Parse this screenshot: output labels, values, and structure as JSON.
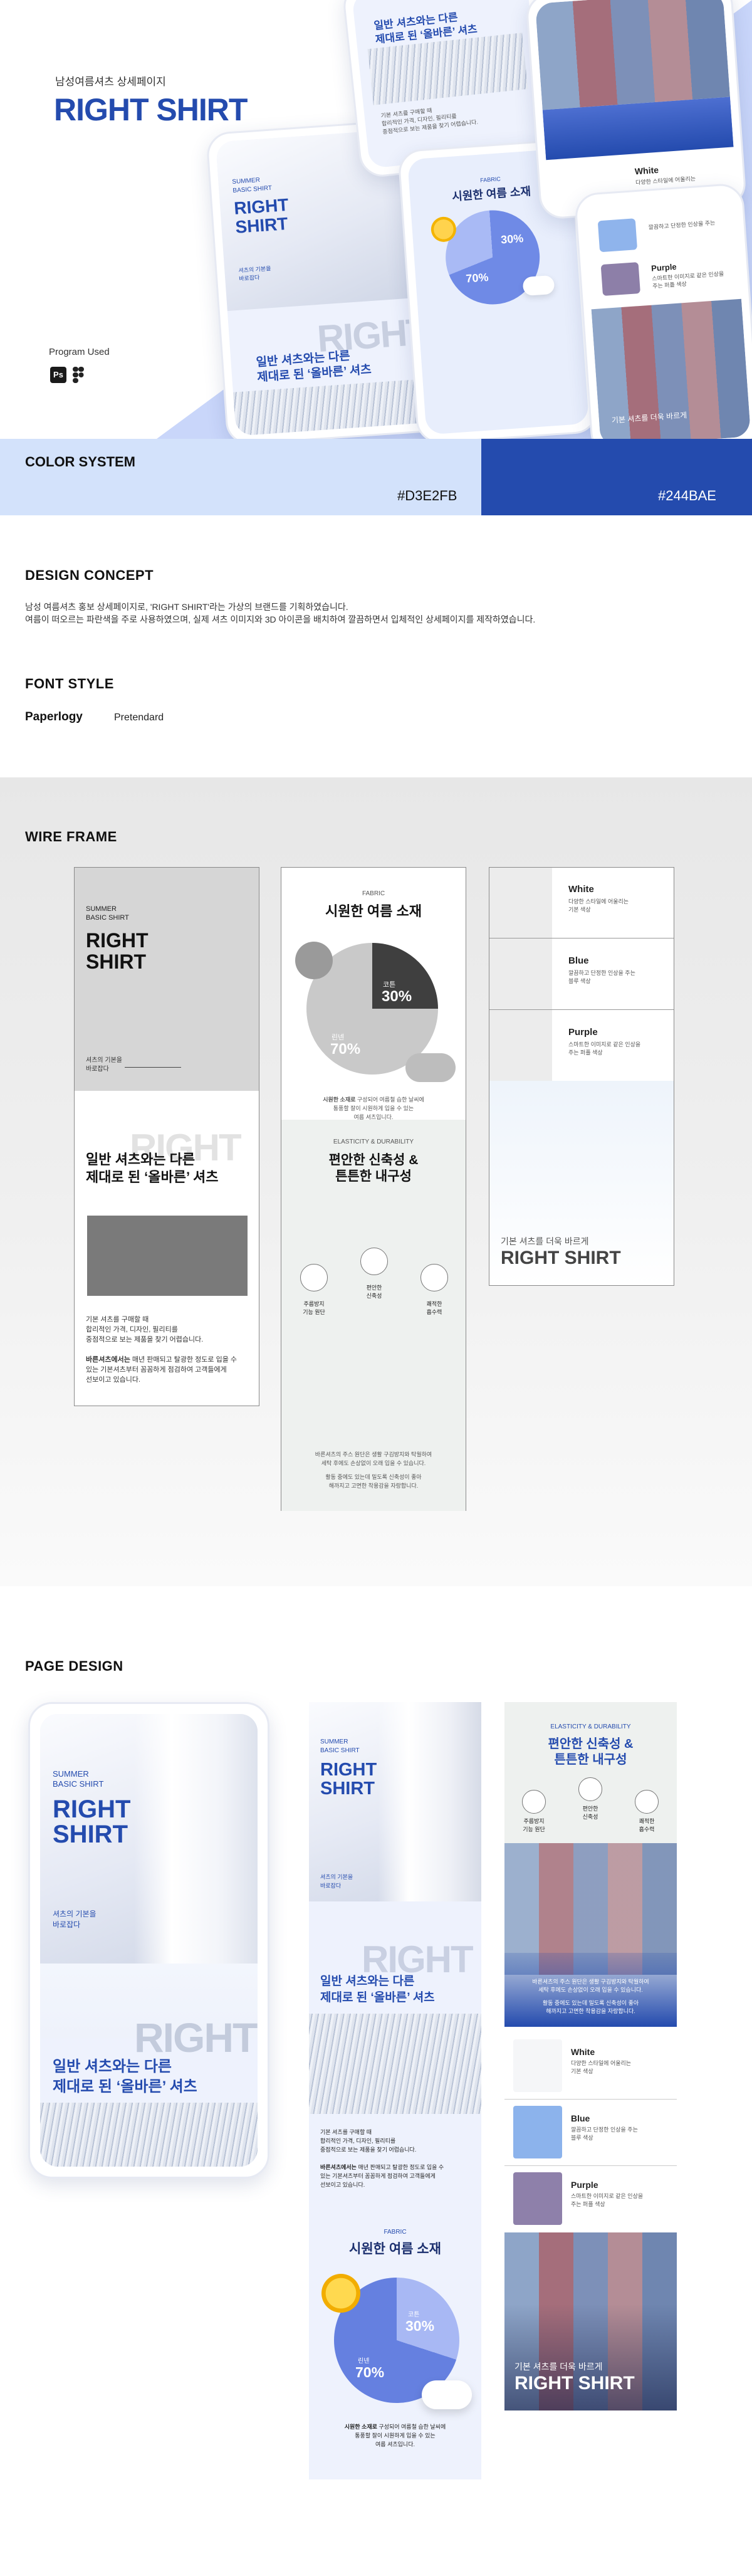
{
  "hero": {
    "subtitle": "남성여름셔츠 상세페이지",
    "title": "RIGHT SHIRT",
    "program_label": "Program Used",
    "program_icons": [
      "photoshop-icon",
      "figma-icon"
    ],
    "ps_text": "Ps"
  },
  "mock": {
    "summer": "SUMMER",
    "basic": "BASIC SHIRT",
    "right": "RIGHT",
    "shirt": "SHIRT",
    "side_note_1": "셔츠의 기본을",
    "side_note_2": "바로잡다",
    "bg_word": "RIGHT",
    "headline_1": "일반 셔츠와는 다른",
    "headline_2": "제대로 된 ‘올바른’ 셔츠",
    "fabric": "FABRIC",
    "fabric_title": "시원한 여름 소재",
    "pct_cotton_label": "코튼",
    "pct_cotton": "30%",
    "pct_linen_label": "린넨",
    "pct_linen": "70%",
    "body_1": "기본 셔츠를 구매할 때",
    "body_2": "합리적인 가격, 디자인, 필리티를",
    "body_3": "중점적으로 보는 제품을 찾기 어렵습니다.",
    "white": "White",
    "white_desc_1": "다양한 스타일에 어울리는",
    "white_desc_2": "기본 색상",
    "blue": "Blue",
    "blue_desc_1": "깔끔하고 단정한 인상을 주는",
    "blue_desc_2": "블루 색상",
    "purple": "Purple",
    "purple_desc_1": "스마트한 이미지로 같은 인상을",
    "purple_desc_2": "주는 퍼플 색상",
    "elastic": "ELASTICITY & DURABILITY",
    "elastic_title_1": "편안한 신축성 &",
    "elastic_title_2": "튼튼한 내구성",
    "feature_1a": "주름방지",
    "feature_1b": "기능 원단",
    "feature_2a": "편안한",
    "feature_2b": "신축성",
    "feature_3a": "쾌적한",
    "feature_3b": "흡수력",
    "closing_1": "기본 셔츠를 더욱 바르게",
    "closing_2": "RIGHT SHIRT"
  },
  "color_system": {
    "title": "COLOR SYSTEM",
    "light_hex": "#D3E2FB",
    "dark_hex": "#244BAE"
  },
  "design_concept": {
    "title": "DESIGN CONCEPT",
    "line_1": "남성 여름셔츠 홍보 상세페이지로, 'RIGHT SHIRT'라는 가상의 브랜드를 기획하였습니다.",
    "line_2": "여름이 떠오르는 파란색을 주로 사용하였으며, 실제 셔츠 이미지와 3D 아이콘을 배치하여 깔끔하면서 입체적인 상세페이지를 제작하였습니다."
  },
  "font_style": {
    "title": "FONT STYLE",
    "font_1": "Paperlogy",
    "font_2": "Pretendard"
  },
  "wire_frame": {
    "title": "WIRE FRAME",
    "body_bold": "바른셔츠에서는",
    "body_rest_1": "매년 판매되고 탈광한 정도로 입을 수",
    "body_rest_2": "있는 기본셔츠부터 꼼꼼하게 점검하여 고객들에게",
    "body_rest_3": "선보이고 있습니다.",
    "fabric_note_bold": "시원한 소재로",
    "fabric_note_1": "구성되어 여름철 습한 날씨에",
    "fabric_note_2": "통풍할 잘이 시원하게 입을 수 있는",
    "fabric_note_3": "여름 셔츠입니다.",
    "elastic_note_1": "바른셔츠의 주스 원단은 생활 구김방지와 탁월하여",
    "elastic_note_2": "세탁 후에도 손상없이 오래 입을 수 있습니다.",
    "elastic_note_3": "활동 중에도 있는데 밀도록 신축성이 좋아",
    "elastic_note_4": "해까지고 고면한 착용감을 자랑합니다."
  },
  "page_design": {
    "title": "PAGE DESIGN"
  }
}
